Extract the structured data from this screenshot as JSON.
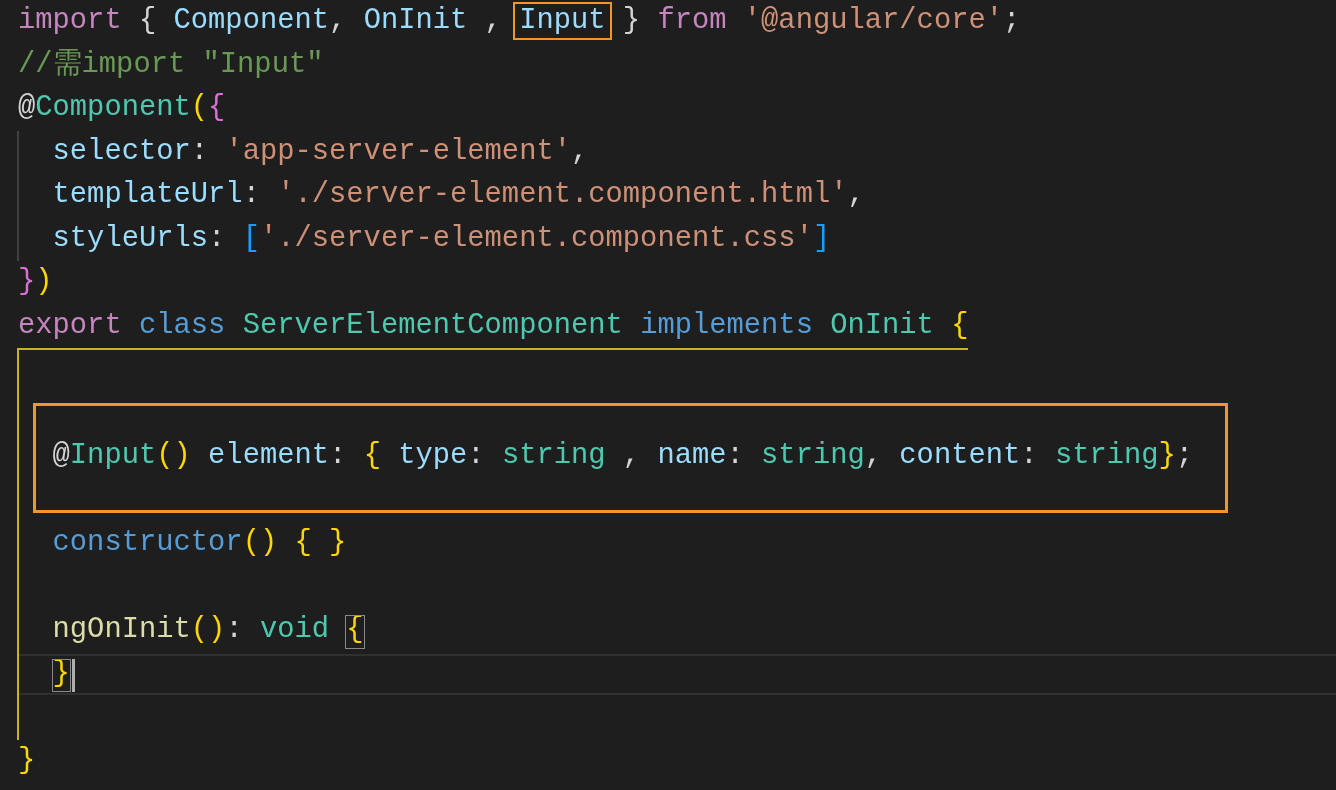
{
  "editor": {
    "lines": [
      {
        "tokens": [
          {
            "text": "import ",
            "kind": "keyword"
          },
          {
            "text": "{ ",
            "kind": "plain"
          },
          {
            "text": "Component",
            "kind": "variable"
          },
          {
            "text": ", ",
            "kind": "plain"
          },
          {
            "text": "OnInit",
            "kind": "variable"
          },
          {
            "text": " , ",
            "kind": "plain"
          },
          {
            "text": "Input",
            "kind": "variable",
            "boxed": true
          },
          {
            "text": " } ",
            "kind": "plain"
          },
          {
            "text": "from ",
            "kind": "keyword"
          },
          {
            "text": "'@angular/core'",
            "kind": "string"
          },
          {
            "text": ";",
            "kind": "plain"
          }
        ]
      },
      {
        "tokens": [
          {
            "text": "//需import \"Input\"",
            "kind": "comment"
          }
        ]
      },
      {
        "tokens": [
          {
            "text": "@",
            "kind": "plain"
          },
          {
            "text": "Component",
            "kind": "type"
          },
          {
            "text": "(",
            "kind": "bracket1"
          },
          {
            "text": "{",
            "kind": "bracket2"
          }
        ]
      },
      {
        "indent_guide": true,
        "guide_active": false,
        "tokens": [
          {
            "text": "  selector",
            "kind": "property"
          },
          {
            "text": ": ",
            "kind": "plain"
          },
          {
            "text": "'app-server-element'",
            "kind": "string"
          },
          {
            "text": ",",
            "kind": "plain"
          }
        ]
      },
      {
        "indent_guide": true,
        "guide_active": false,
        "tokens": [
          {
            "text": "  templateUrl",
            "kind": "property"
          },
          {
            "text": ": ",
            "kind": "plain"
          },
          {
            "text": "'./server-element.component.html'",
            "kind": "string"
          },
          {
            "text": ",",
            "kind": "plain"
          }
        ]
      },
      {
        "indent_guide": true,
        "guide_active": false,
        "tokens": [
          {
            "text": "  styleUrls",
            "kind": "property"
          },
          {
            "text": ": ",
            "kind": "plain"
          },
          {
            "text": "[",
            "kind": "bracket3"
          },
          {
            "text": "'./server-element.component.css'",
            "kind": "string"
          },
          {
            "text": "]",
            "kind": "bracket3"
          }
        ]
      },
      {
        "tokens": [
          {
            "text": "}",
            "kind": "bracket2"
          },
          {
            "text": ")",
            "kind": "bracket1"
          }
        ]
      },
      {
        "bracket_guide": true,
        "tokens": [
          {
            "text": "export ",
            "kind": "keyword"
          },
          {
            "text": "class ",
            "kind": "storage"
          },
          {
            "text": "ServerElementComponent ",
            "kind": "type"
          },
          {
            "text": "implements ",
            "kind": "storage"
          },
          {
            "text": "OnInit ",
            "kind": "type"
          },
          {
            "text": "{",
            "kind": "bracket1"
          }
        ]
      },
      {
        "indent_guide": true,
        "guide_active": true
      },
      {
        "indent_guide": true,
        "guide_active": true
      },
      {
        "indent_guide": true,
        "guide_active": true,
        "boxed": true,
        "tokens": [
          {
            "text": "  @",
            "kind": "plain"
          },
          {
            "text": "Input",
            "kind": "type"
          },
          {
            "text": "()",
            "kind": "bracket1"
          },
          {
            "text": " element",
            "kind": "property"
          },
          {
            "text": ": ",
            "kind": "plain"
          },
          {
            "text": "{",
            "kind": "bracket1"
          },
          {
            "text": " type",
            "kind": "property"
          },
          {
            "text": ": ",
            "kind": "plain"
          },
          {
            "text": "string",
            "kind": "type"
          },
          {
            "text": " , ",
            "kind": "plain"
          },
          {
            "text": "name",
            "kind": "property"
          },
          {
            "text": ": ",
            "kind": "plain"
          },
          {
            "text": "string",
            "kind": "type"
          },
          {
            "text": ", ",
            "kind": "plain"
          },
          {
            "text": "content",
            "kind": "property"
          },
          {
            "text": ": ",
            "kind": "plain"
          },
          {
            "text": "string",
            "kind": "type"
          },
          {
            "text": "}",
            "kind": "bracket1"
          },
          {
            "text": ";",
            "kind": "plain"
          }
        ]
      },
      {
        "indent_guide": true,
        "guide_active": true
      },
      {
        "indent_guide": true,
        "guide_active": true,
        "tokens": [
          {
            "text": "  constructor",
            "kind": "storage"
          },
          {
            "text": "() ",
            "kind": "bracket1"
          },
          {
            "text": "{ }",
            "kind": "bracket1"
          }
        ]
      },
      {
        "indent_guide": true,
        "guide_active": true
      },
      {
        "indent_guide": true,
        "guide_active": true,
        "tokens": [
          {
            "text": "  ngOnInit",
            "kind": "func"
          },
          {
            "text": "()",
            "kind": "bracket1"
          },
          {
            "text": ": ",
            "kind": "plain"
          },
          {
            "text": "void ",
            "kind": "type"
          },
          {
            "text": "{",
            "kind": "bracket1",
            "matched": true
          }
        ]
      },
      {
        "indent_guide": true,
        "guide_active": true,
        "current": true,
        "tokens": [
          {
            "text": "  }",
            "kind": "bracket1",
            "matched": true
          }
        ]
      },
      {
        "indent_guide": true,
        "guide_active": true
      },
      {
        "tokens": [
          {
            "text": "}",
            "kind": "bracket1"
          }
        ]
      }
    ]
  }
}
